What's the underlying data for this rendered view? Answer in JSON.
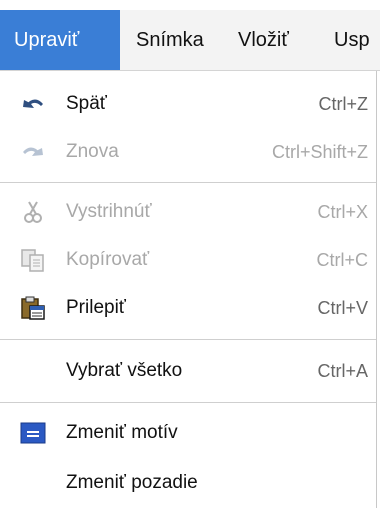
{
  "menubar": {
    "items": [
      {
        "label": "Upraviť"
      },
      {
        "label": "Snímka"
      },
      {
        "label": "Vložiť"
      },
      {
        "label": "Usp"
      }
    ]
  },
  "menu": {
    "undo": {
      "label": "Späť",
      "shortcut": "Ctrl+Z",
      "icon": "undo-icon"
    },
    "redo": {
      "label": "Znova",
      "shortcut": "Ctrl+Shift+Z",
      "icon": "redo-icon"
    },
    "cut": {
      "label": "Vystrihnúť",
      "shortcut": "Ctrl+X",
      "icon": "scissors-icon"
    },
    "copy": {
      "label": "Kopírovať",
      "shortcut": "Ctrl+C",
      "icon": "copy-icon"
    },
    "paste": {
      "label": "Prilepiť",
      "shortcut": "Ctrl+V",
      "icon": "clipboard-icon"
    },
    "select_all": {
      "label": "Vybrať všetko",
      "shortcut": "Ctrl+A"
    },
    "change_theme": {
      "label": "Zmeniť motív",
      "icon": "theme-icon"
    },
    "change_background": {
      "label": "Zmeniť pozadie"
    }
  },
  "colors": {
    "active_menu": "#3a7ed6",
    "disabled_text": "#a8a8a8"
  }
}
